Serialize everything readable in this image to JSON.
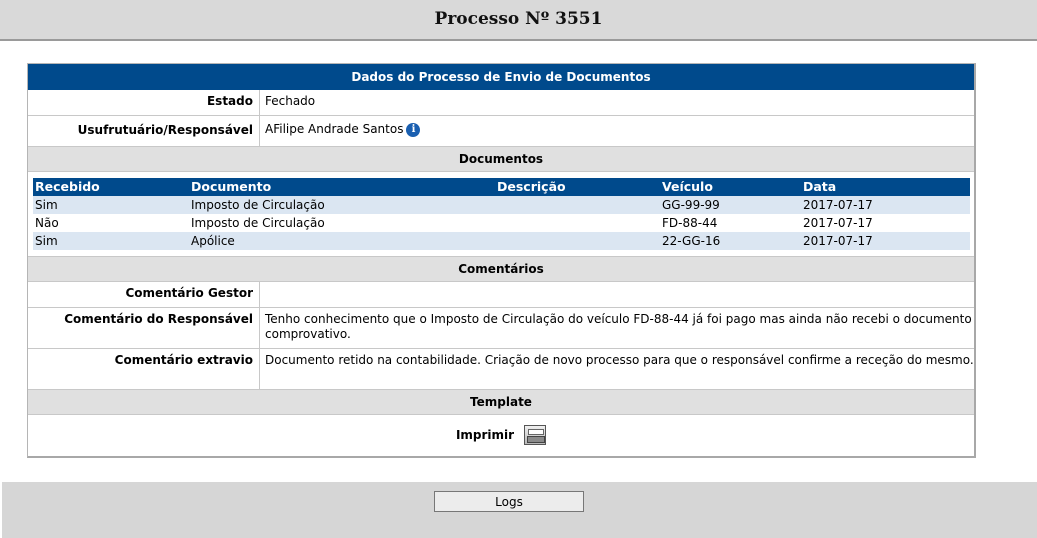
{
  "header": {
    "title": "Processo Nº 3551"
  },
  "panel": {
    "title": "Dados do Processo de Envio de Documentos",
    "estado_label": "Estado",
    "estado_value": "Fechado",
    "responsavel_label": "Usufrutuário/Responsável",
    "responsavel_value": "AFilipe Andrade Santos",
    "info_icon": "i"
  },
  "documentos": {
    "section_title": "Documentos",
    "columns": [
      "Recebido",
      "Documento",
      "Descrição",
      "Veículo",
      "Data"
    ],
    "rows": [
      [
        "Sim",
        "Imposto de Circulação",
        "",
        "GG-99-99",
        "2017-07-17"
      ],
      [
        "Não",
        "Imposto de Circulação",
        "",
        "FD-88-44",
        "2017-07-17"
      ],
      [
        "Sim",
        "Apólice",
        "",
        "22-GG-16",
        "2017-07-17"
      ]
    ]
  },
  "comentarios": {
    "section_title": "Comentários",
    "gestor_label": "Comentário Gestor",
    "gestor_value": "",
    "responsavel_label": "Comentário do Responsável",
    "responsavel_value": "Tenho conhecimento que o Imposto de Circulação do veículo FD-88-44 já foi pago mas ainda não recebi o documento comprovativo.",
    "extravio_label": "Comentário extravio",
    "extravio_value": "Documento retido na contabilidade. Criação de novo processo para que o responsável confirme a receção do mesmo."
  },
  "template": {
    "section_title": "Template",
    "print_label": "Imprimir",
    "print_icon": "printer-icon"
  },
  "footer": {
    "logs_label": "Logs"
  },
  "colors": {
    "header_blue": "#004a8c",
    "row_alt": "#dbe6f2",
    "section_gray": "#e0e0e0"
  }
}
